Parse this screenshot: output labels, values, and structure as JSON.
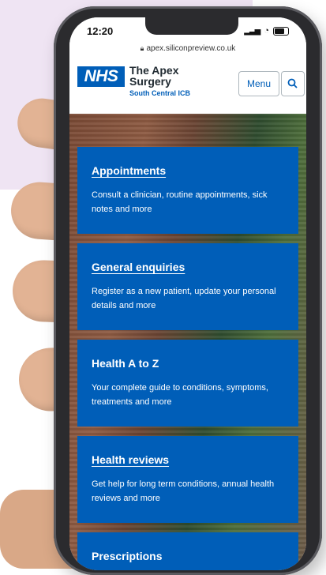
{
  "status": {
    "time": "12:20"
  },
  "browser": {
    "url": "apex.siliconpreview.co.uk"
  },
  "header": {
    "logo": "NHS",
    "org_name_line1": "The Apex",
    "org_name_line2": "Surgery",
    "org_sub": "South Central ICB",
    "menu_label": "Menu"
  },
  "cards": [
    {
      "title": "Appointments",
      "desc": "Consult a clinician, routine appointments, sick notes and more"
    },
    {
      "title": "General enquiries",
      "desc": "Register as a new patient, update your personal details and more"
    },
    {
      "title": "Health A to Z",
      "desc": "Your complete guide to conditions, symptoms, treatments and more"
    },
    {
      "title": "Health reviews",
      "desc": "Get help for long term conditions, annual health reviews and more"
    },
    {
      "title": "Prescriptions",
      "desc": ""
    }
  ],
  "colors": {
    "nhs_blue": "#005eb8",
    "lilac_bg": "#efe4f3"
  }
}
